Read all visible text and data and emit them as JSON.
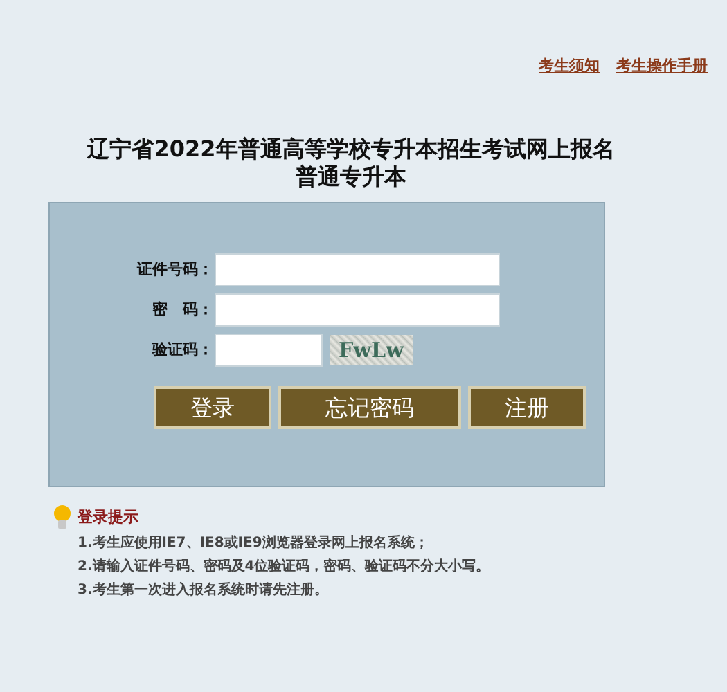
{
  "top_links": [
    "考生须知",
    "考生操作手册"
  ],
  "title": [
    "辽宁省2022年普通高等学校专升本招生考试网上报名",
    "普通专升本"
  ],
  "form": {
    "fields": [
      {
        "label": "证件号码：",
        "kind": "wide"
      },
      {
        "label": "密　码：",
        "kind": "wide"
      },
      {
        "label": "验证码：",
        "kind": "captcha",
        "captcha": "FwLw"
      }
    ],
    "buttons": [
      {
        "label": "登录"
      },
      {
        "label": "忘记密码"
      },
      {
        "label": "注册"
      }
    ]
  },
  "tips": {
    "heading": "登录提示",
    "items": [
      "1.考生应使用IE7、IE8或IE9浏览器登录网上报名系统；",
      "2.请输入证件号码、密码及4位验证码，密码、验证码不分大小写。",
      "3.考生第一次进入报名系统时请先注册。"
    ]
  }
}
